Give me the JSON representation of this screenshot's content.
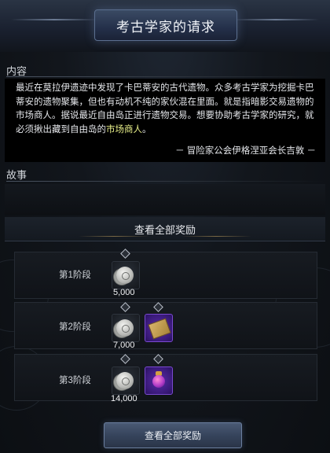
{
  "header": {
    "title": "考古学家的请求"
  },
  "content": {
    "label": "内容",
    "text_pre": "最近在莫拉伊遗迹中发现了卡巴蒂安的古代遗物。众多考古学家为挖掘卡巴蒂安的遗物聚集，但也有动机不纯的家伙混在里面。就是指暗影交易遗物的市场商人。据说最近自由岛正进行遗物交易。想要协助考古学家的研究，就必须揪出藏到自由岛的",
    "text_highlight": "市场商人",
    "text_post": "。",
    "signature": "－ 冒险家公会伊格涅亚会长吉敦 －"
  },
  "story": {
    "label": "故事"
  },
  "rewards": {
    "header": "查看全部奖励",
    "stages": [
      {
        "label": "第1阶段",
        "qty": "5,000"
      },
      {
        "label": "第2阶段",
        "qty": "7,000"
      },
      {
        "label": "第3阶段",
        "qty": "14,000"
      }
    ]
  },
  "footer": {
    "button_label": "查看全部奖励"
  },
  "colors": {
    "highlight": "#e9f08a",
    "accent": "#4a5a74"
  },
  "icons": [
    "silver-coin-icon",
    "scroll-icon",
    "purple-orb-icon",
    "diamond-marker-icon"
  ]
}
